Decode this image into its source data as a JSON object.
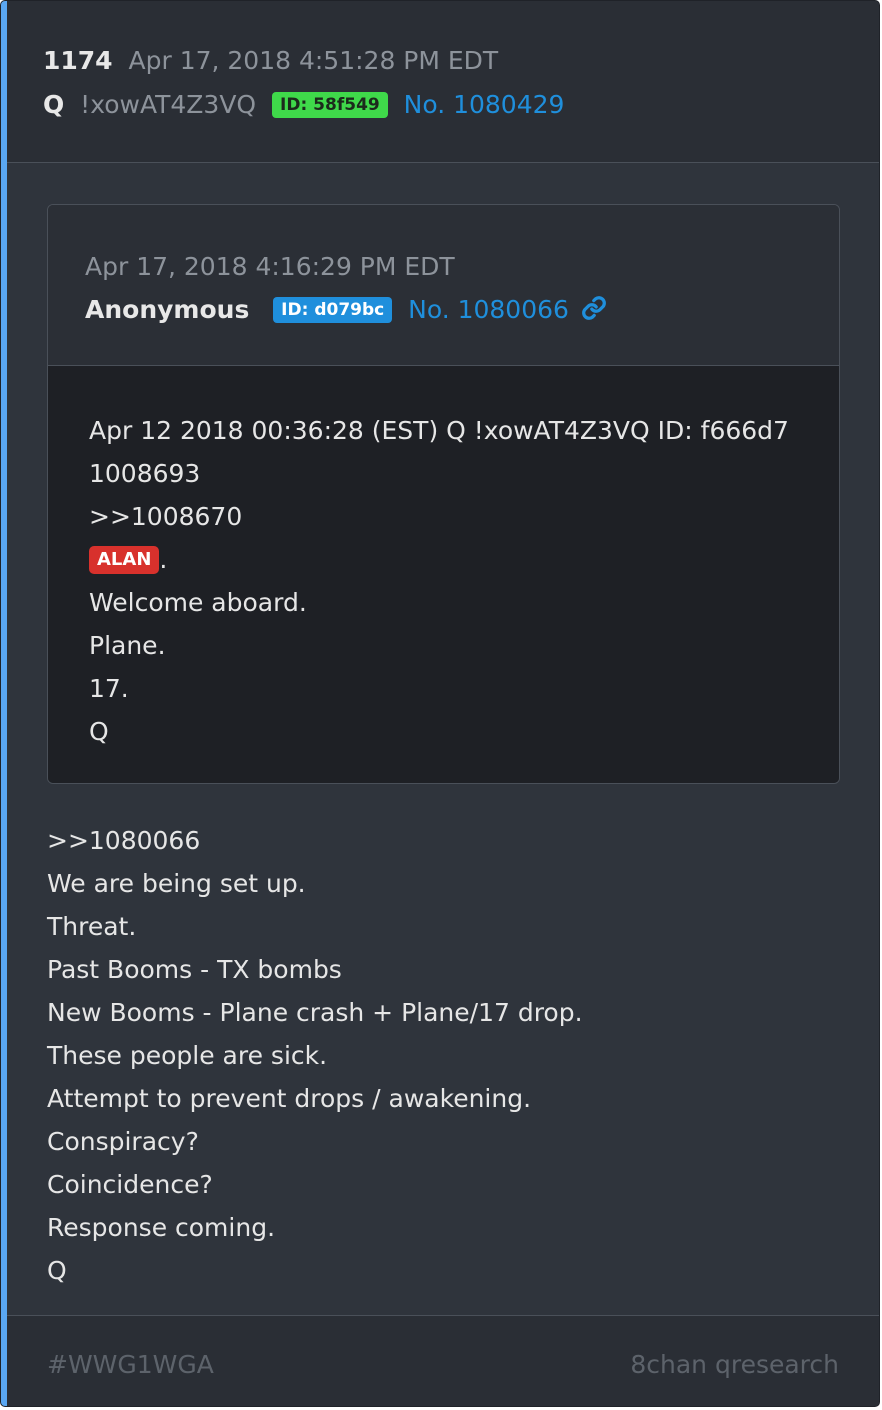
{
  "post": {
    "number": "1174",
    "timestamp": "Apr 17, 2018 4:51:28 PM EDT",
    "author": "Q",
    "tripcode": "!xowAT4Z3VQ",
    "id_badge": "ID: 58f549",
    "post_link": "No. 1080429"
  },
  "quoted": {
    "timestamp": "Apr 17, 2018 4:16:29 PM EDT",
    "author": "Anonymous",
    "id_badge": "ID: d079bc",
    "post_link": "No. 1080066",
    "lines": [
      "Apr 12 2018 00:36:28 (EST) Q !xowAT4Z3VQ ID: f666d7",
      "1008693",
      ">>1008670"
    ],
    "highlight": "ALAN",
    "highlight_suffix": ".",
    "lines_after": [
      "Welcome aboard.",
      "Plane.",
      "17.",
      "Q"
    ]
  },
  "body_lines": [
    ">>1080066",
    "We are being set up.",
    "Threat.",
    "Past Booms - TX bombs",
    "New Booms - Plane crash + Plane/17 drop.",
    "These people are sick.",
    "Attempt to prevent drops / awakening.",
    "Conspiracy?",
    "Coincidence?",
    "Response coming.",
    "Q"
  ],
  "footer": {
    "hashtag": "#WWG1WGA",
    "source": "8chan qresearch"
  },
  "colors": {
    "accent": "#5aa7f2",
    "link": "#1f8fdc",
    "id_green": "#3fd94a",
    "highlight_red": "#d8312c"
  },
  "icons": [
    "link-icon"
  ]
}
